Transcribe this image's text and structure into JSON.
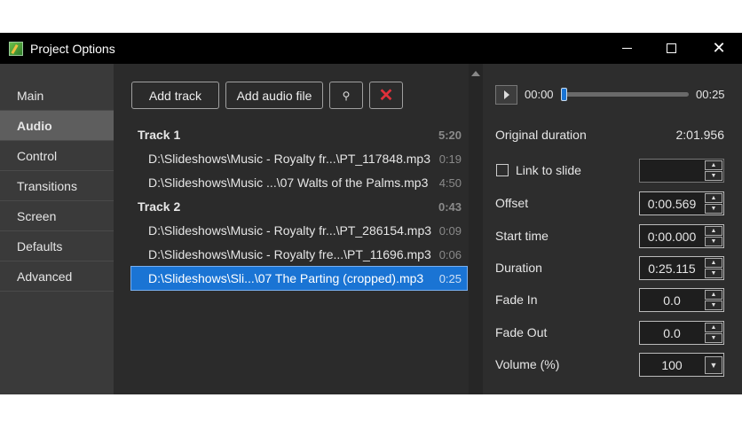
{
  "window": {
    "title": "Project Options"
  },
  "sidebar": {
    "items": [
      {
        "label": "Main"
      },
      {
        "label": "Audio"
      },
      {
        "label": "Control"
      },
      {
        "label": "Transitions"
      },
      {
        "label": "Screen"
      },
      {
        "label": "Defaults"
      },
      {
        "label": "Advanced"
      }
    ],
    "active": "Audio"
  },
  "toolbar": {
    "add_track": "Add track",
    "add_audio_file": "Add audio file"
  },
  "tracks": [
    {
      "name": "Track 1",
      "time": "5:20",
      "files": [
        {
          "path": "D:\\Slideshows\\Music - Royalty fr...\\PT_117848.mp3",
          "time": "0:19"
        },
        {
          "path": "D:\\Slideshows\\Music ...\\07 Walts of the Palms.mp3",
          "time": "4:50"
        }
      ]
    },
    {
      "name": "Track 2",
      "time": "0:43",
      "files": [
        {
          "path": "D:\\Slideshows\\Music - Royalty fr...\\PT_286154.mp3",
          "time": "0:09"
        },
        {
          "path": "D:\\Slideshows\\Music - Royalty fre...\\PT_11696.mp3",
          "time": "0:06"
        },
        {
          "path": "D:\\Slideshows\\Sli...\\07 The Parting (cropped).mp3",
          "time": "0:25"
        }
      ]
    }
  ],
  "player": {
    "current": "00:00",
    "total": "00:25",
    "progress": 0
  },
  "props": {
    "original_duration_label": "Original duration",
    "original_duration": "2:01.956",
    "link_to_slide": "Link to slide",
    "link_checked": false,
    "offset_label": "Offset",
    "offset": "0:00.569",
    "start_label": "Start time",
    "start": "0:00.000",
    "duration_label": "Duration",
    "duration": "0:25.115",
    "fade_in_label": "Fade In",
    "fade_in": "0.0",
    "fade_out_label": "Fade Out",
    "fade_out": "0.0",
    "volume_label": "Volume (%)",
    "volume": "100"
  },
  "colors": {
    "selection": "#1a74d4",
    "delete": "#e0303a"
  }
}
